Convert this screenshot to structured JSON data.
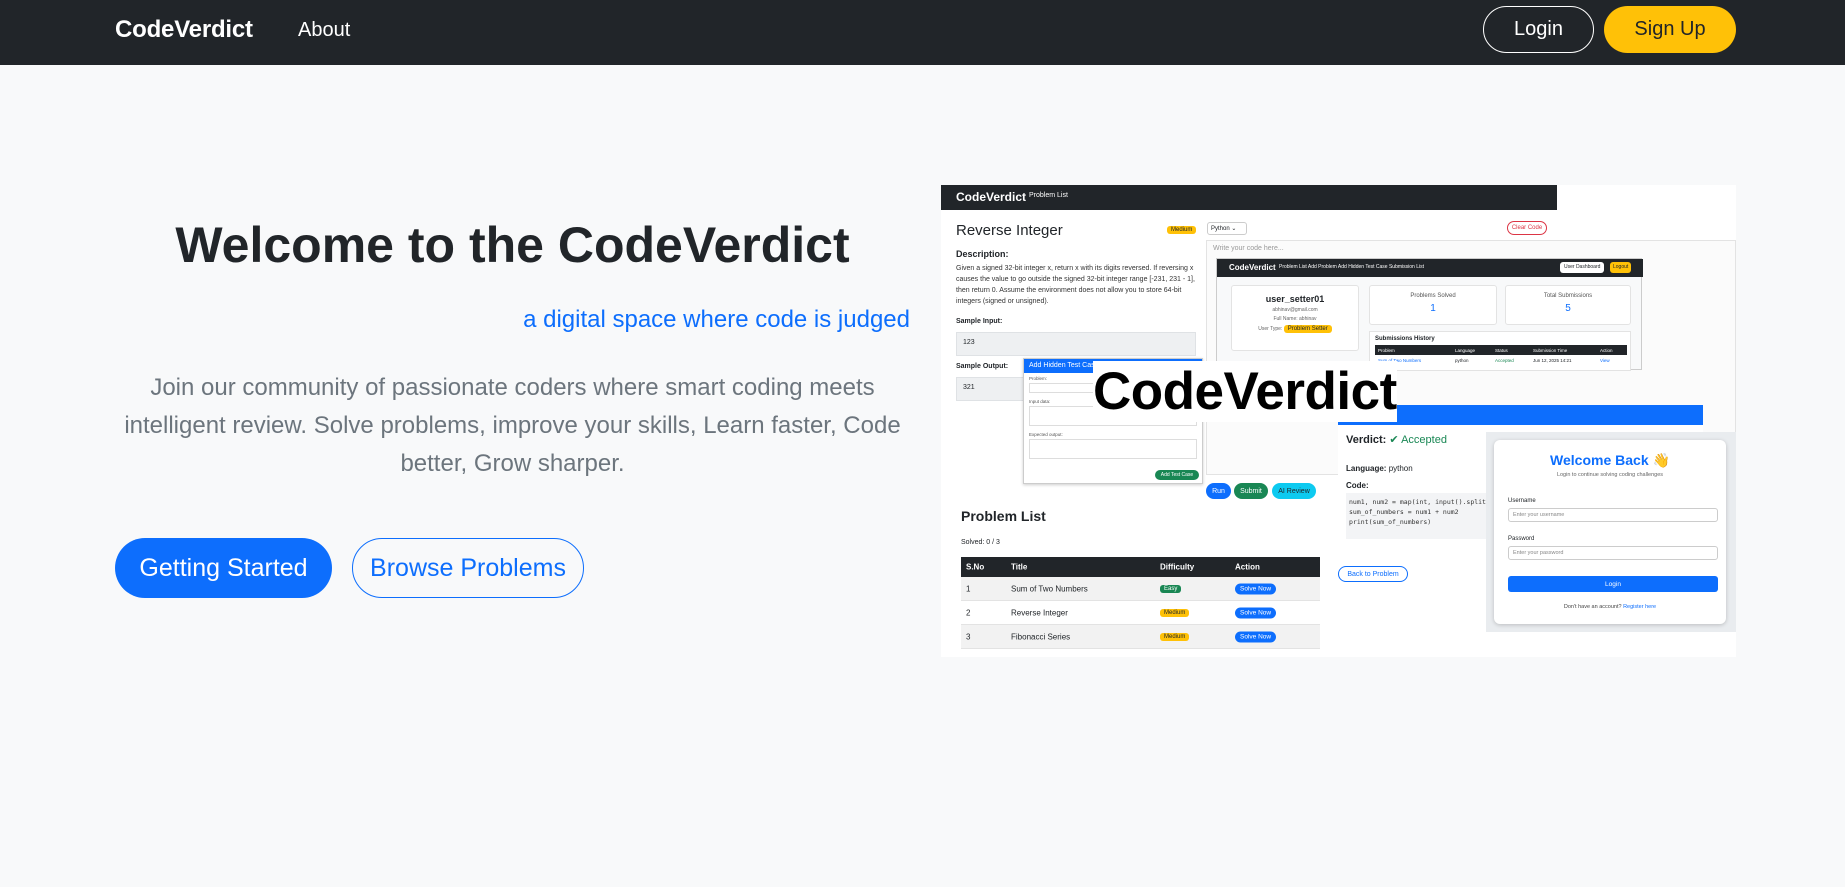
{
  "nav": {
    "brand": "CodeVerdict",
    "about": "About",
    "login": "Login",
    "signup": "Sign Up"
  },
  "hero": {
    "title": "Welcome to the CodeVerdict",
    "subtitle": "a digital space where code is judged",
    "description": "Join our community of passionate coders where smart coding meets intelligent review. Solve problems, improve your skills, Learn faster, Code better, Grow sharper.",
    "getting_started": "Getting Started",
    "browse_problems": "Browse Problems"
  },
  "preview": {
    "brand": "CodeVerdict",
    "nav_link": "Problem List",
    "problem_title": "Reverse Integer",
    "problem_badge": "Medium",
    "description_label": "Description:",
    "description": "Given a signed 32-bit integer x, return x with its digits reversed. If reversing x causes the value to go outside the signed 32-bit integer range [-231, 231 - 1], then return 0. Assume the environment does not allow you to store 64-bit integers (signed or unsigned).",
    "sample_input_label": "Sample Input:",
    "sample_input": "123",
    "sample_output_label": "Sample Output:",
    "sample_output": "321",
    "language": "Python",
    "clear_code": "Clear Code",
    "code_placeholder": "Write your code here...",
    "run": "Run",
    "submit": "Submit",
    "ai_review": "AI Review",
    "big_logo": "CodeVerdict",
    "dashboard": {
      "brand": "CodeVerdict",
      "links": "Problem List   Add Problem   Add Hidden Test Case   Submission List",
      "user_button": "User Dashboard",
      "logout": "Logout",
      "username": "user_setter01",
      "email": "abhinav@gmail.com",
      "full_name": "Full Name: abhinav",
      "user_type": "User Type:",
      "user_type_badge": "Problem Setter",
      "problems_solved_label": "Problems Solved",
      "problems_solved": "1",
      "total_submissions_label": "Total Submissions",
      "total_submissions": "5",
      "history_title": "Submissions History",
      "history_headers": [
        "Problem",
        "Language",
        "Status",
        "Submission Time",
        "Action"
      ],
      "history_row": [
        "Sum of Two Numbers",
        "python",
        "Accepted",
        "Jun 12, 2025 14:21",
        "View"
      ]
    },
    "add_case": {
      "title": "Add Hidden Test Case",
      "problem_label": "Problem:",
      "input_label": "Input data:",
      "expected_label": "Expected output:",
      "button": "Add Test Case"
    },
    "verdict": {
      "label": "Verdict:",
      "status": "Accepted",
      "language_label": "Language:",
      "language": "python",
      "code_label": "Code:",
      "code": "num1, num2 = map(int, input().split\nsum_of_numbers = num1 + num2\nprint(sum_of_numbers)",
      "back": "Back to Problem"
    },
    "login_card": {
      "title": "Welcome Back 👋",
      "subtitle": "Login to continue solving coding challenges",
      "username_label": "Username",
      "username_placeholder": "Enter your username",
      "password_label": "Password",
      "password_placeholder": "Enter your password",
      "button": "Login",
      "footer": "Don't have an account?",
      "register": "Register here"
    },
    "problem_list": {
      "title": "Problem List",
      "solved": "Solved: 0 / 3",
      "headers": [
        "S.No",
        "Title",
        "Difficulty",
        "Action"
      ],
      "rows": [
        {
          "no": "1",
          "title": "Sum of Two Numbers",
          "difficulty": "Easy",
          "action": "Solve Now"
        },
        {
          "no": "2",
          "title": "Reverse Integer",
          "difficulty": "Medium",
          "action": "Solve Now"
        },
        {
          "no": "3",
          "title": "Fibonacci Series",
          "difficulty": "Medium",
          "action": "Solve Now"
        }
      ]
    }
  }
}
